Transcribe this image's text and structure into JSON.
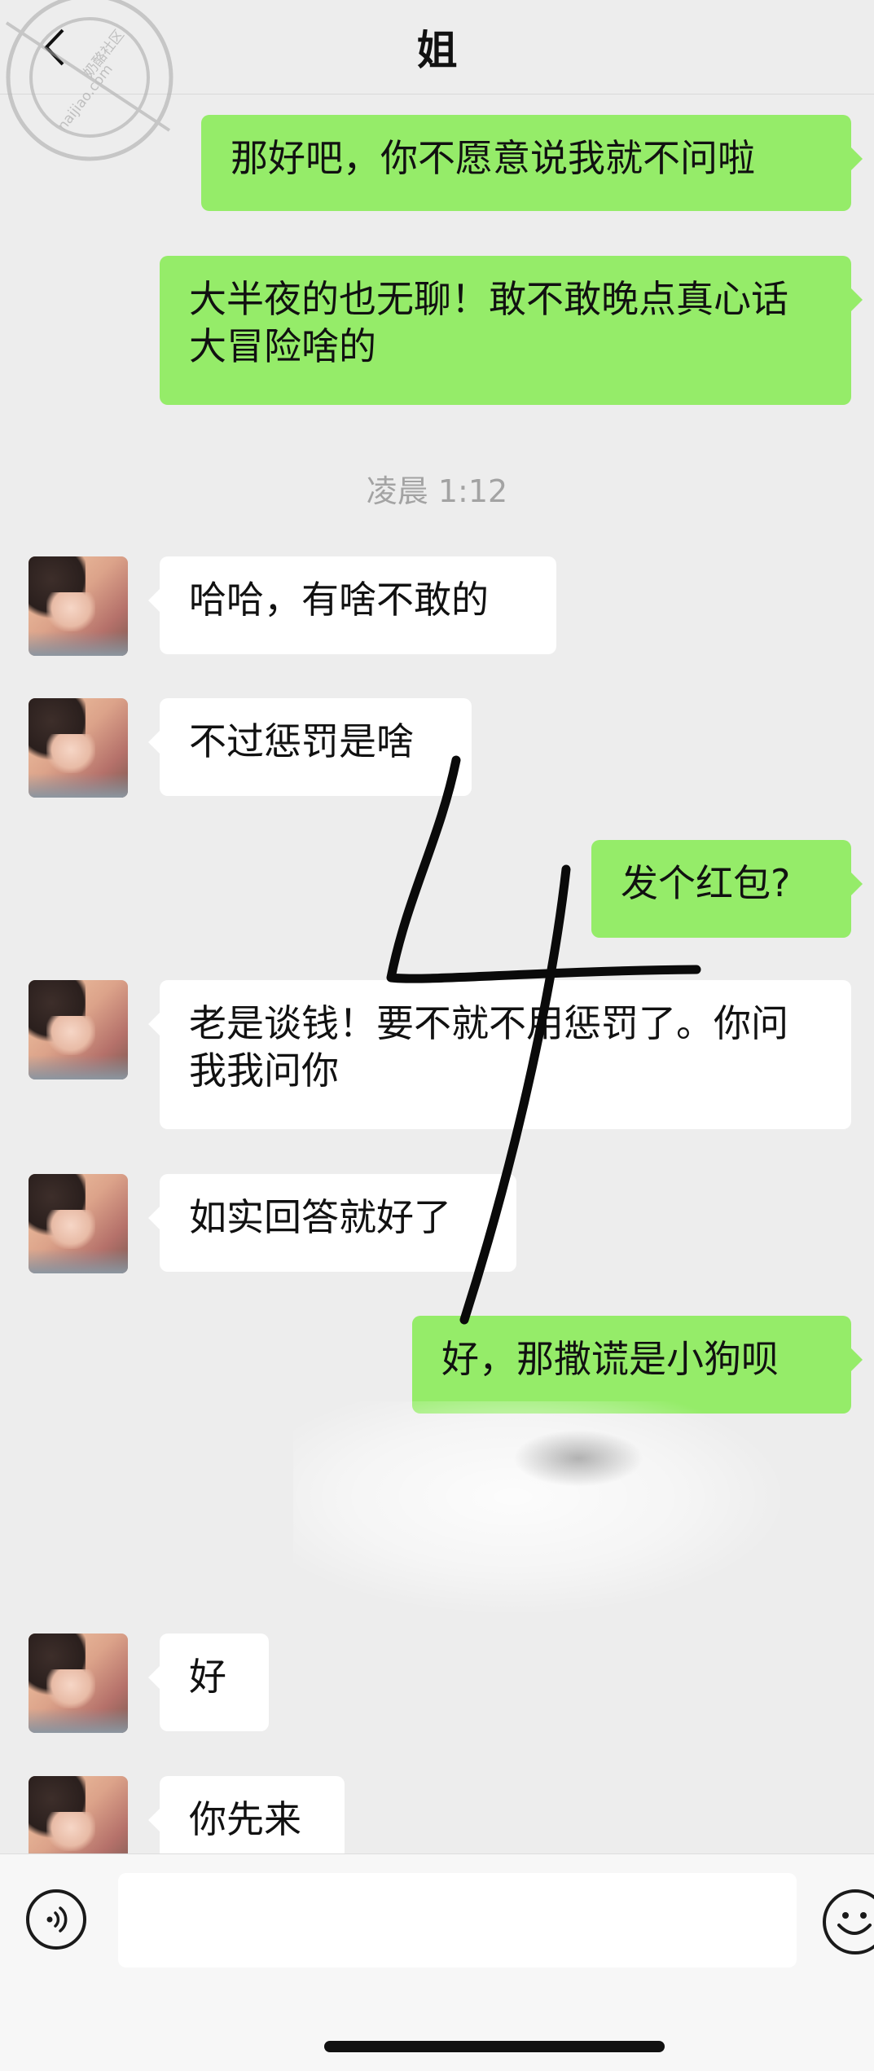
{
  "header": {
    "title": "姐",
    "back_icon": "chevron-left-icon"
  },
  "watermark": {
    "line1": "奶酪社区",
    "line2": "naijiao.com"
  },
  "messages": [
    {
      "side": "right",
      "text": "那好吧，你不愿意说我就不问啦"
    },
    {
      "side": "right",
      "text": "大半夜的也无聊！敢不敢晚点真心话大冒险啥的"
    },
    {
      "side": "left",
      "text": "哈哈，有啥不敢的"
    },
    {
      "side": "left",
      "text": "不过惩罚是啥"
    },
    {
      "side": "right",
      "text": "发个红包?"
    },
    {
      "side": "left",
      "text": "老是谈钱！要不就不用惩罚了。你问我我问你"
    },
    {
      "side": "left",
      "text": "如实回答就好了"
    },
    {
      "side": "right",
      "text": "好，那撒谎是小狗呗"
    },
    {
      "side": "left",
      "text": "好"
    },
    {
      "side": "left",
      "text": "你先来"
    }
  ],
  "timestamp": "凌晨 1:12",
  "annotation": "4",
  "input_bar": {
    "voice_icon": "voice-icon",
    "emoji_icon": "emoji-icon",
    "value": ""
  },
  "colors": {
    "background": "#ededed",
    "sent_bubble": "#95ec69",
    "received_bubble": "#ffffff",
    "timestamp_text": "#a3a3a3"
  }
}
